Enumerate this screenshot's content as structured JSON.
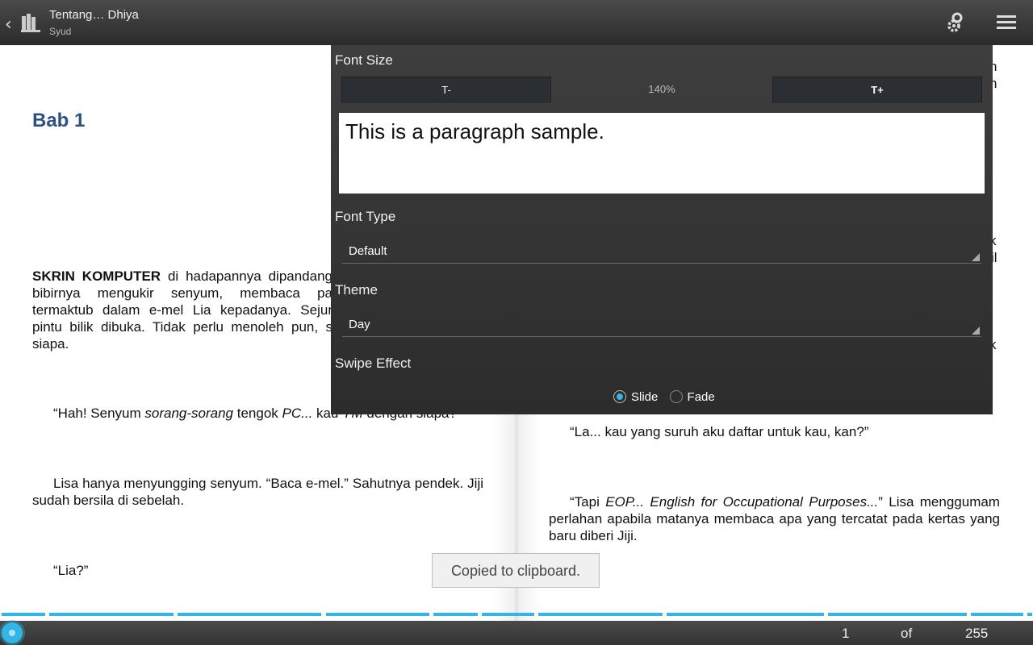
{
  "header": {
    "title": "Tentang… Dhiya",
    "subtitle": "Syud"
  },
  "book": {
    "chapter_title": "Bab 1",
    "left_paragraphs": [
      {
        "lead_bold": "SKRIN KOMPUTER",
        "text": " di hadapannya dipandang bibirnya mengukir senyum, membaca pa termaktub dalam e-mel Lia kepadanya. Sejur pintu bilik dibuka. Tidak perlu menoleh pun, s siapa."
      },
      {
        "parts": [
          "“Hah! Senyum ",
          "sorang-sorang",
          " tengok ",
          "PC...",
          " kau ",
          "YM",
          " dengan siapa?"
        ]
      },
      {
        "text": "Lisa hanya menyungging senyum. “Baca e-mel.” Sahutnya pendek. Jiji sudah bersila di sebelah."
      },
      {
        "text": "“Lia?”"
      }
    ],
    "right_fragments": [
      "n",
      "h",
      "k",
      "il",
      "k"
    ],
    "right_paragraphs": [
      {
        "text": "“La... kau yang suruh aku daftar untuk kau, kan?”"
      },
      {
        "parts": [
          "“Tapi ",
          "EOP... English for Occupational Purposes...",
          "” Lisa menggumam perlahan apabila matanya membaca apa yang tercatat pada kertas yang baru diberi Jiji."
        ]
      }
    ]
  },
  "settings": {
    "font_size_label": "Font Size",
    "decrease_label": "T-",
    "size_value": "140%",
    "increase_label": "T+",
    "sample_text": "This is a paragraph sample.",
    "font_type_label": "Font Type",
    "font_type_value": "Default",
    "theme_label": "Theme",
    "theme_value": "Day",
    "swipe_label": "Swipe Effect",
    "swipe_options": [
      "Slide",
      "Fade"
    ],
    "swipe_selected": "Slide"
  },
  "toast": "Copied to clipboard.",
  "footer": {
    "current_page": "1",
    "of_label": "of",
    "total_pages": "255",
    "progress_fraction": 0.004
  },
  "colors": {
    "accent": "#33b5e5",
    "chapter": "#2c5282",
    "bar_dark": "#2b2b2b"
  }
}
